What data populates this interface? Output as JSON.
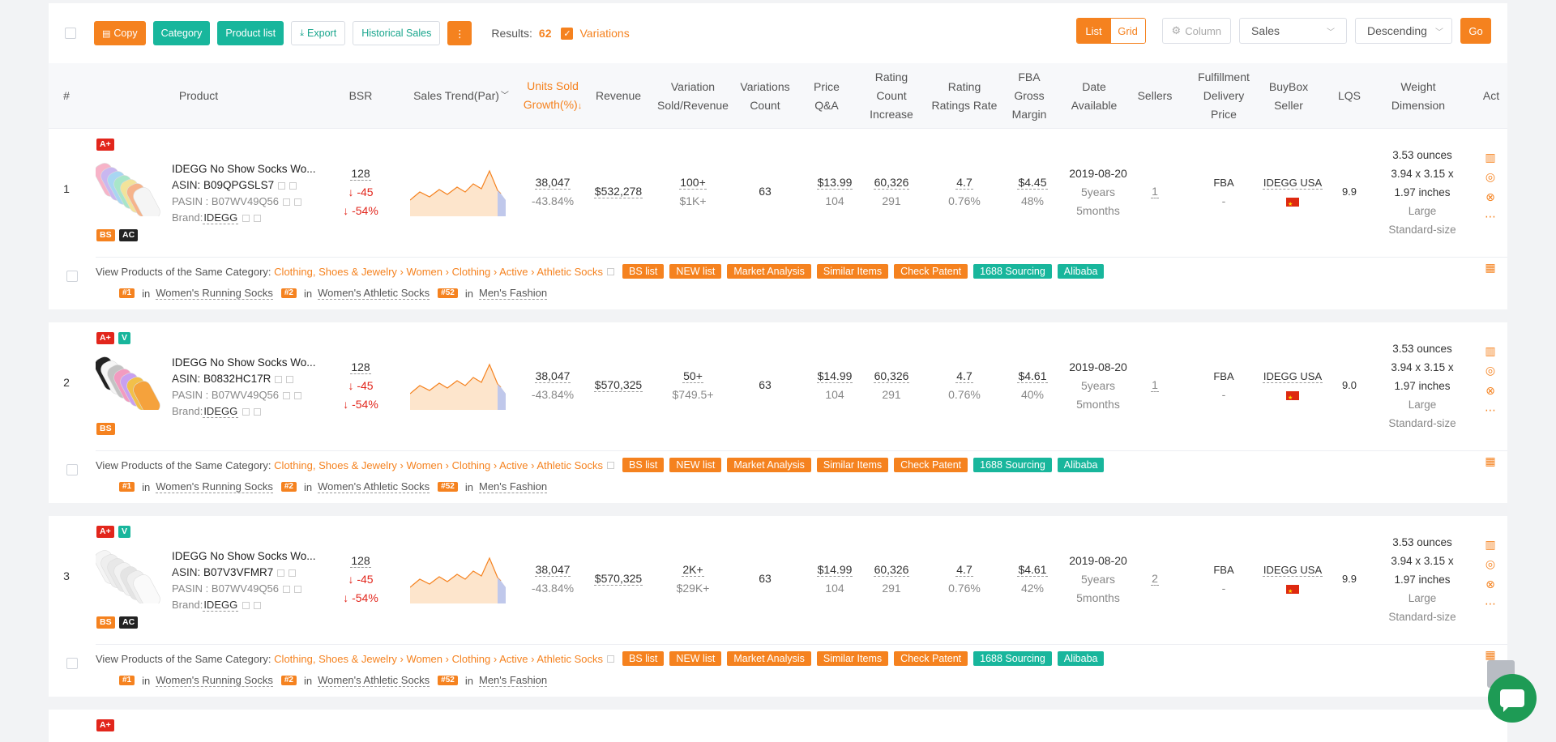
{
  "toolbar": {
    "copy": "Copy",
    "category": "Category",
    "product_list": "Product list",
    "export": "Export",
    "historical_sales": "Historical Sales",
    "results_label": "Results:",
    "results_count": "62",
    "variations": "Variations",
    "view_list": "List",
    "view_grid": "Grid",
    "column": "Column",
    "sort_field": "Sales",
    "sort_order": "Descending",
    "go": "Go"
  },
  "columns": {
    "index": "#",
    "product": "Product",
    "bsr": "BSR",
    "sales_trend": "Sales Trend(Par)",
    "units_sold_1": "Units Sold",
    "units_sold_2": "Growth(%)",
    "revenue": "Revenue",
    "variation_1": "Variation",
    "variation_2": "Sold/Revenue",
    "var_count_1": "Variations",
    "var_count_2": "Count",
    "price_1": "Price",
    "price_2": "Q&A",
    "rating_count_1": "Rating",
    "rating_count_2": "Count",
    "rating_count_3": "Increase",
    "rating_1": "Rating",
    "rating_2": "Ratings Rate",
    "fba_1": "FBA",
    "fba_2": "Gross",
    "fba_3": "Margin",
    "date_1": "Date",
    "date_2": "Available",
    "sellers": "Sellers",
    "fulfill_1": "Fulfillment",
    "fulfill_2": "Delivery",
    "fulfill_3": "Price",
    "buybox_1": "BuyBox",
    "buybox_2": "Seller",
    "lqs": "LQS",
    "weight_1": "Weight",
    "weight_2": "Dimension",
    "act": "Act"
  },
  "rows": [
    {
      "index": "1",
      "title": "IDEGG No Show Socks Wo...",
      "asin_label": "ASIN:",
      "asin": "B09QPGSLS7",
      "pasin_label": "PASIN :",
      "pasin": "B07WV49Q56",
      "brand_label": "Brand:",
      "brand": "IDEGG",
      "bsr": "128",
      "bsr_change": "↓ -45",
      "bsr_pct": "↓ -54%",
      "units": "38,047",
      "units_growth": "-43.84%",
      "revenue": "$532,278",
      "var_sold": "100+",
      "var_revenue": "$1K+",
      "var_count": "63",
      "price": "$13.99",
      "qa": "104",
      "rating_count": "60,326",
      "rating_inc": "291",
      "rating": "4.7",
      "rating_rate": "0.76%",
      "fba": "$4.45",
      "margin": "48%",
      "date": "2019-08-20",
      "age_years": "5years",
      "age_months": "5months",
      "sellers": "1",
      "fulfillment": "FBA",
      "delivery": "-",
      "buybox": "IDEGG USA",
      "lqs": "9.9",
      "weight": "3.53 ounces",
      "dim1": "3.94 x 3.15 x",
      "dim2": "1.97 inches",
      "size1": "Large",
      "size2": "Standard-size"
    },
    {
      "index": "2",
      "title": "IDEGG No Show Socks Wo...",
      "asin_label": "ASIN:",
      "asin": "B0832HC17R",
      "pasin_label": "PASIN :",
      "pasin": "B07WV49Q56",
      "brand_label": "Brand:",
      "brand": "IDEGG",
      "bsr": "128",
      "bsr_change": "↓ -45",
      "bsr_pct": "↓ -54%",
      "units": "38,047",
      "units_growth": "-43.84%",
      "revenue": "$570,325",
      "var_sold": "50+",
      "var_revenue": "$749.5+",
      "var_count": "63",
      "price": "$14.99",
      "qa": "104",
      "rating_count": "60,326",
      "rating_inc": "291",
      "rating": "4.7",
      "rating_rate": "0.76%",
      "fba": "$4.61",
      "margin": "40%",
      "date": "2019-08-20",
      "age_years": "5years",
      "age_months": "5months",
      "sellers": "1",
      "fulfillment": "FBA",
      "delivery": "-",
      "buybox": "IDEGG USA",
      "lqs": "9.0",
      "weight": "3.53 ounces",
      "dim1": "3.94 x 3.15 x",
      "dim2": "1.97 inches",
      "size1": "Large",
      "size2": "Standard-size"
    },
    {
      "index": "3",
      "title": "IDEGG No Show Socks Wo...",
      "asin_label": "ASIN:",
      "asin": "B07V3VFMR7",
      "pasin_label": "PASIN :",
      "pasin": "B07WV49Q56",
      "brand_label": "Brand:",
      "brand": "IDEGG",
      "bsr": "128",
      "bsr_change": "↓ -45",
      "bsr_pct": "↓ -54%",
      "units": "38,047",
      "units_growth": "-43.84%",
      "revenue": "$570,325",
      "var_sold": "2K+",
      "var_revenue": "$29K+",
      "var_count": "63",
      "price": "$14.99",
      "qa": "104",
      "rating_count": "60,326",
      "rating_inc": "291",
      "rating": "4.7",
      "rating_rate": "0.76%",
      "fba": "$4.61",
      "margin": "42%",
      "date": "2019-08-20",
      "age_years": "5years",
      "age_months": "5months",
      "sellers": "2",
      "fulfillment": "FBA",
      "delivery": "-",
      "buybox": "IDEGG USA",
      "lqs": "9.9",
      "weight": "3.53 ounces",
      "dim1": "3.94 x 3.15 x",
      "dim2": "1.97 inches",
      "size1": "Large",
      "size2": "Standard-size"
    }
  ],
  "category_line": {
    "prefix": "View Products of the Same Category:",
    "path": "Clothing, Shoes & Jewelry › Women › Clothing › Active › Athletic Socks",
    "tags": [
      "BS list",
      "NEW list",
      "Market Analysis",
      "Similar Items",
      "Check Patent"
    ],
    "tags_teal": [
      "1688 Sourcing",
      "Alibaba"
    ]
  },
  "ranks": [
    {
      "rank": "#1",
      "in": "in",
      "name": "Women's Running Socks"
    },
    {
      "rank": "#2",
      "in": "in",
      "name": "Women's Athletic Socks"
    },
    {
      "rank": "#52",
      "in": "in",
      "name": "Men's Fashion"
    }
  ],
  "badges": {
    "aplus": "A+",
    "v": "V",
    "bs": "BS",
    "ac": "AC"
  },
  "colors": {
    "accent": "#f5821f",
    "teal": "#18b69c",
    "red": "#e2261c"
  }
}
